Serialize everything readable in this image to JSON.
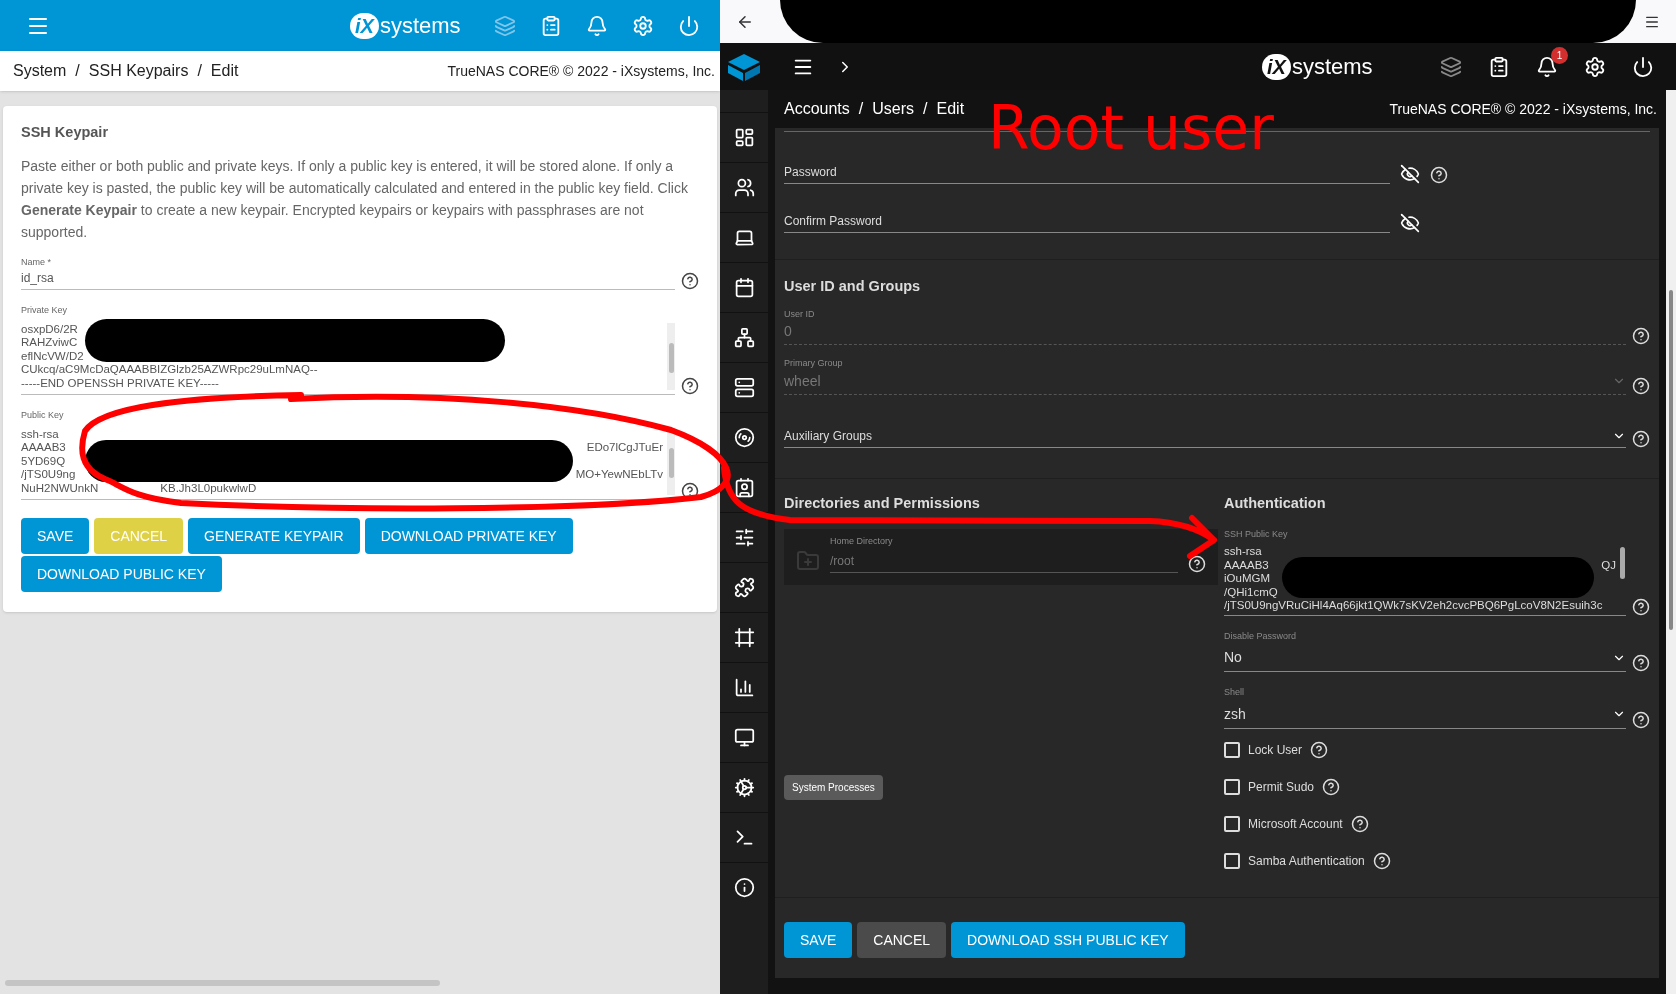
{
  "left": {
    "header": {
      "logo": {
        "mark": "iX",
        "word": "systems"
      }
    },
    "breadcrumb": [
      {
        "text": "System",
        "kind": "link"
      },
      {
        "text": "/",
        "kind": "separator"
      },
      {
        "text": "SSH Keypairs",
        "kind": "link"
      },
      {
        "text": "/",
        "kind": "separator"
      },
      {
        "text": "Edit",
        "kind": "current"
      }
    ],
    "copyright": "TrueNAS CORE® © 2022 - iXsystems, Inc.",
    "card": {
      "title": "SSH Keypair",
      "description": "Paste either or both public and private keys. If only a public key is entered, it will be stored alone. If only a private key is pasted, the public key will be automatically calculated and entered in the public key field. Click **Generate Keypair** to create a new keypair. Encrypted keypairs or keypairs with passphrases are not supported.",
      "name_field": {
        "label": "Name *",
        "value": "id_rsa"
      },
      "private_key": {
        "label": "Private Key",
        "lines": [
          {
            "left": "osxpD6/2R"
          },
          {
            "left": "RAHZviwC"
          },
          {
            "left": "eflNcVW/D2"
          },
          {
            "left": "CUkcq/aC9McDaQAAABBIZGlzb25AZWRpc29uLmNAQ--"
          },
          {
            "left": "-----END OPENSSH PRIVATE KEY-----"
          }
        ]
      },
      "public_key": {
        "label": "Public Key",
        "lines": [
          {
            "left": "ssh-rsa"
          },
          {
            "left": "AAAAB3",
            "right": "EDo7lCgJTuEr"
          },
          {
            "left": "5YD69Q"
          },
          {
            "left": "/jTS0U9ng",
            "right": "MO+YewNEbLTv"
          },
          {
            "left": "NuH2NWUnkN",
            "gap": "KB.Jh3L0pukwlwD"
          }
        ]
      },
      "buttons": [
        {
          "label": "SAVE",
          "kind": "primary"
        },
        {
          "label": "CANCEL",
          "kind": "warning"
        },
        {
          "label": "GENERATE KEYPAIR",
          "kind": "primary"
        },
        {
          "label": "DOWNLOAD PRIVATE KEY",
          "kind": "primary"
        },
        {
          "label": "DOWNLOAD PUBLIC KEY",
          "kind": "primary"
        }
      ]
    }
  },
  "right": {
    "header": {
      "logo": {
        "mark": "iX",
        "word": "systems"
      },
      "notification_count": "1"
    },
    "breadcrumb": [
      {
        "text": "Accounts",
        "kind": "link"
      },
      {
        "text": "/",
        "kind": "separator"
      },
      {
        "text": "Users",
        "kind": "link"
      },
      {
        "text": "/",
        "kind": "separator"
      },
      {
        "text": "Edit",
        "kind": "current"
      }
    ],
    "copyright": "TrueNAS CORE® © 2022 - iXsystems, Inc.",
    "annotation": "Root user",
    "password_fields": [
      {
        "label": "Password",
        "help": true
      },
      {
        "label": "Confirm Password",
        "help": false
      }
    ],
    "user_section": {
      "title": "User ID and Groups",
      "fields": [
        {
          "label": "User ID",
          "value": "0",
          "disabled": true,
          "kind": "input"
        },
        {
          "label": "Primary Group",
          "value": "wheel",
          "disabled": true,
          "kind": "select"
        },
        {
          "placeholder": "Auxiliary Groups",
          "disabled": false,
          "kind": "select"
        }
      ]
    },
    "directories": {
      "title": "Directories and Permissions",
      "home": {
        "label": "Home Directory",
        "value": "/root",
        "disabled": true
      }
    },
    "tooltip": "System Processes",
    "authentication": {
      "title": "Authentication",
      "ssh_key": {
        "label": "SSH Public Key",
        "lines": [
          {
            "left": "ssh-rsa"
          },
          {
            "left": "AAAAB3",
            "right": "QJ"
          },
          {
            "left": "iOuMGM"
          },
          {
            "left": "/QHi1cmQ"
          },
          {
            "left": "/jTS0U9ngVRuCiHl4Aq66jkt1QWk7sKV2eh2cvcPBQ6PgLcoV8N2Esuih3c"
          }
        ]
      },
      "selects": [
        {
          "label": "Disable Password",
          "value": "No"
        },
        {
          "label": "Shell",
          "value": "zsh"
        }
      ],
      "checkboxes": [
        {
          "label": "Lock User",
          "checked": false
        },
        {
          "label": "Permit Sudo",
          "checked": false
        },
        {
          "label": "Microsoft Account",
          "checked": false
        },
        {
          "label": "Samba Authentication",
          "checked": false
        }
      ]
    },
    "buttons": [
      {
        "label": "SAVE",
        "kind": "primary"
      },
      {
        "label": "CANCEL",
        "kind": "secondary"
      },
      {
        "label": "DOWNLOAD SSH PUBLIC KEY",
        "kind": "primary"
      }
    ]
  }
}
